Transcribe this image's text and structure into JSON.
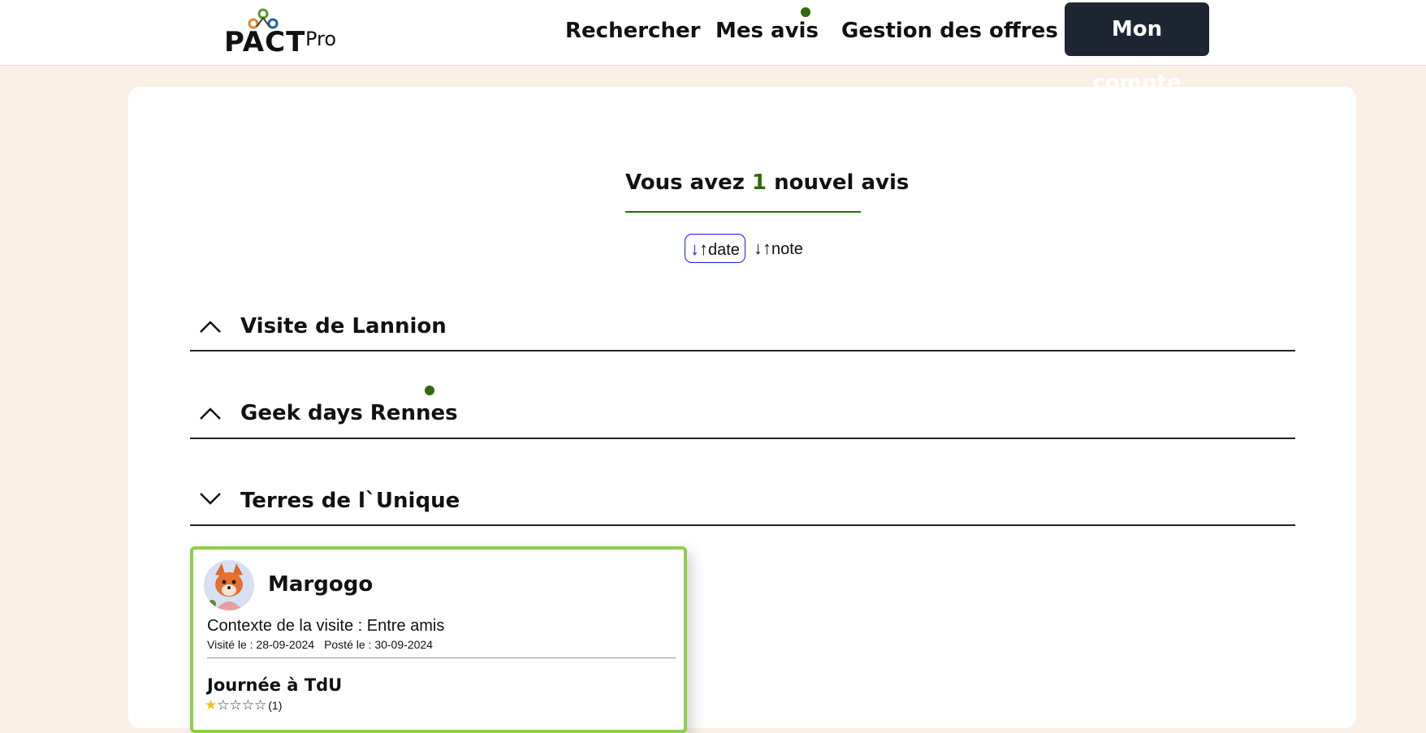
{
  "header": {
    "logo_text": "PACT",
    "logo_suffix": "Pro",
    "nav": [
      {
        "label": "Rechercher"
      },
      {
        "label": "Mes avis"
      },
      {
        "label": "Gestion des offres"
      }
    ],
    "account_label": "Mon compte"
  },
  "headline": {
    "prefix": "Vous avez",
    "count": "1",
    "suffix": "nouvel avis"
  },
  "sort": {
    "date_label": "date",
    "note_label": "note",
    "active": "date"
  },
  "sections": [
    {
      "title": "Visite de Lannion",
      "expanded": true,
      "has_new": false
    },
    {
      "title": "Geek days Rennes",
      "expanded": true,
      "has_new": true
    },
    {
      "title": "Terres de l`Unique",
      "expanded": false,
      "has_new": false
    }
  ],
  "review": {
    "author": "Margogo",
    "context": "Contexte de la visite : Entre amis",
    "visited": "Visité le : 28-09-2024",
    "posted": "Posté le : 30-09-2024",
    "title": "Journée à TdU",
    "rating": 1,
    "rating_max": 5,
    "rating_count": "(1)"
  },
  "colors": {
    "accent_green": "#2f6a0c",
    "review_border": "#8ccf4a",
    "account_bg": "#1e2533",
    "page_bg": "#faf0e6",
    "sort_active": "#1a1ae0"
  }
}
